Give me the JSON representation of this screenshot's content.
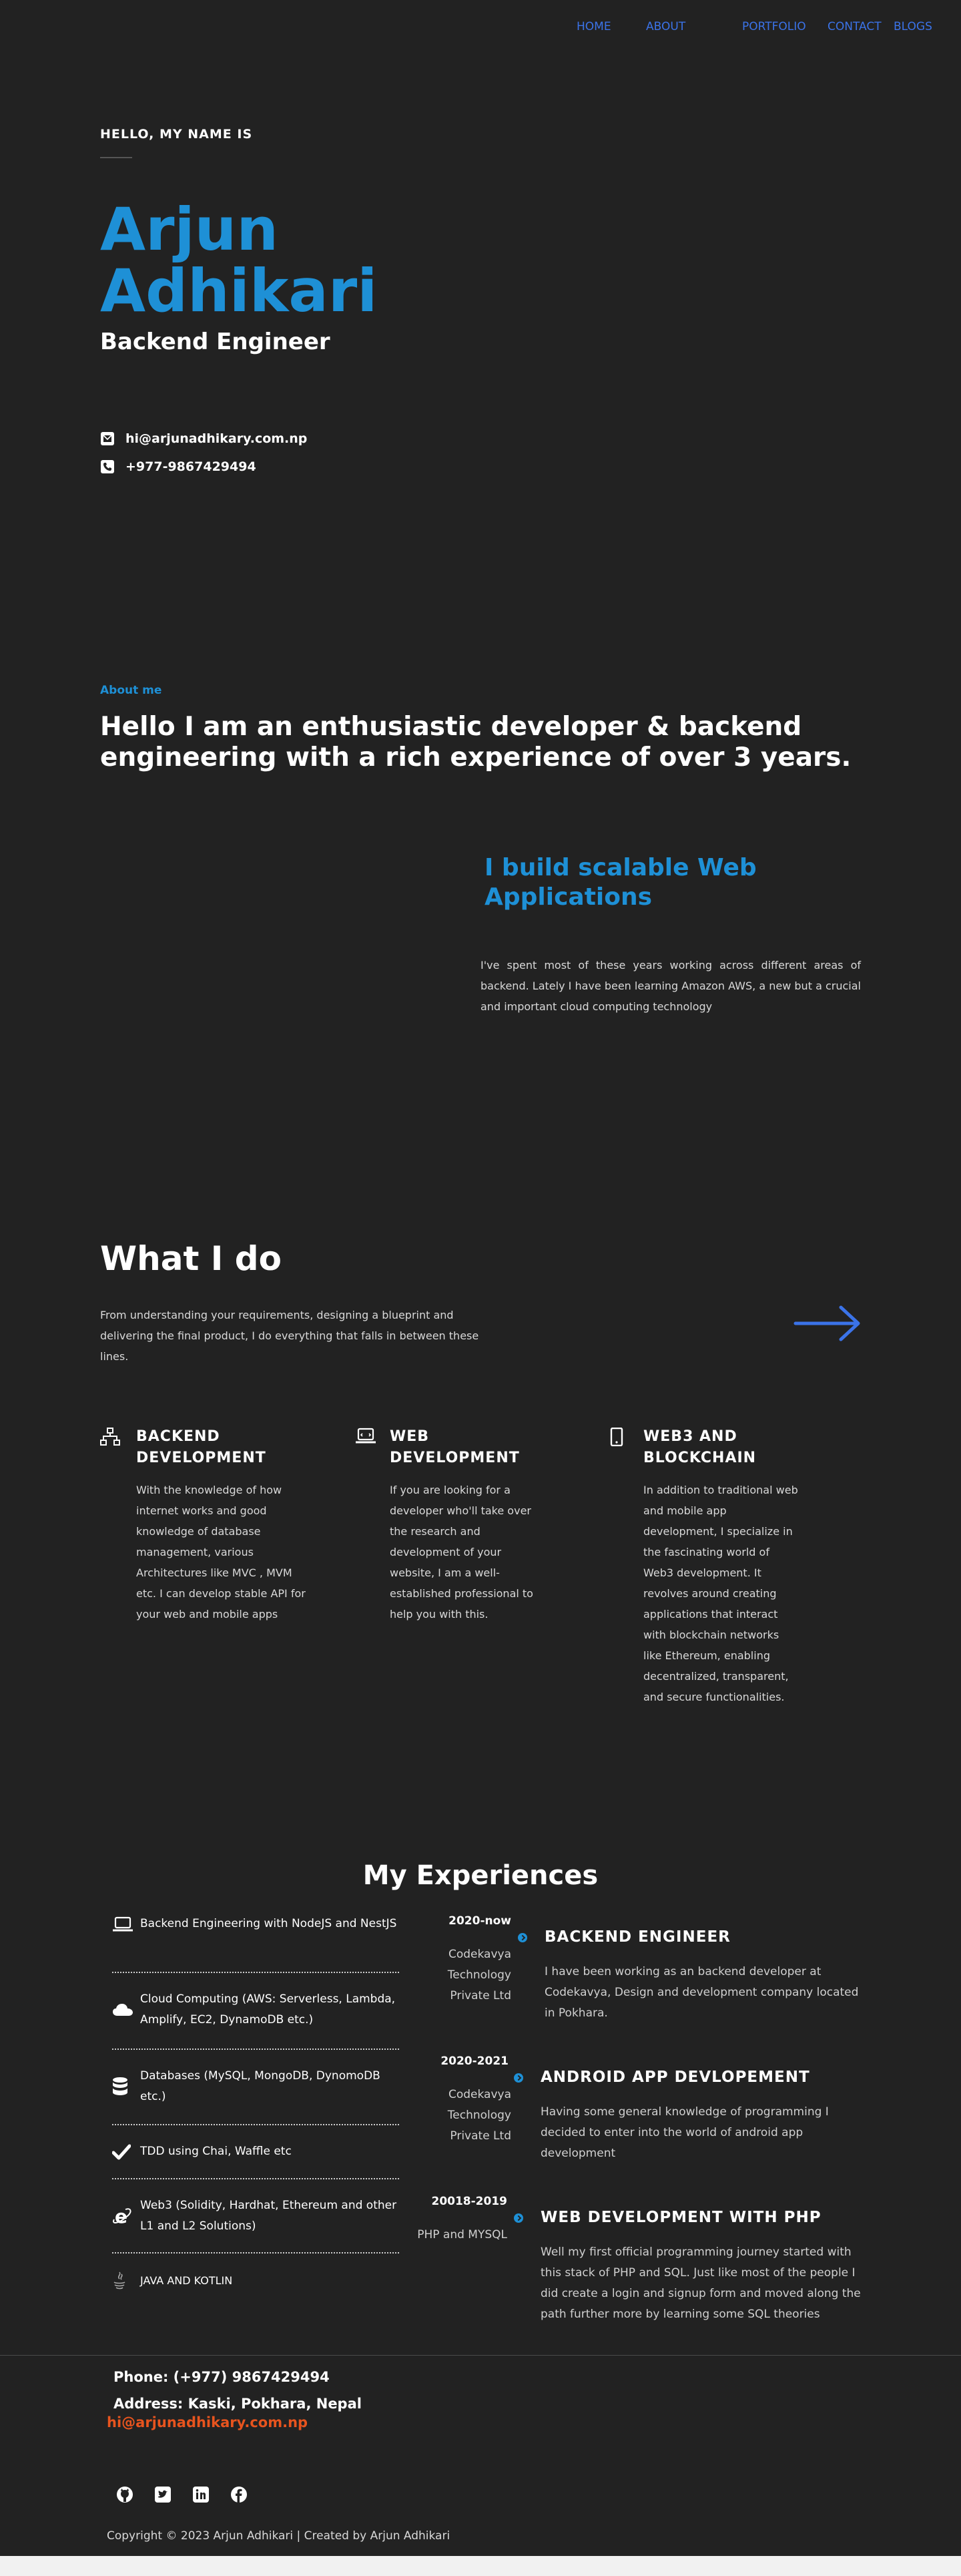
{
  "nav": {
    "home": "HOME",
    "about": "ABOUT",
    "portfolio": "PORTFOLIO",
    "contact": "CONTACT",
    "blogs": "BLOGS"
  },
  "hero": {
    "greeting": "HELLO, MY NAME IS",
    "first_name": "Arjun",
    "last_name": "Adhikari",
    "role": "Backend Engineer",
    "email": "hi@arjunadhikary.com.np",
    "phone": "+977-9867429494"
  },
  "about": {
    "label": "About me",
    "title": "Hello I am an enthusiastic developer & backend engineering with a rich experience of over 3 years.",
    "subtitle": "I build scalable Web Applications",
    "text": "I've spent most of these years working across different areas of backend. Lately I have been learning Amazon AWS, a new but a crucial and important cloud computing technology"
  },
  "what_i_do": {
    "title": "What I do",
    "text": "From understanding your requirements, designing a blueprint and delivering the final product, I do everything that falls in between these lines.",
    "services": [
      {
        "icon": "sitemap-icon",
        "title": "BACKEND DEVELOPMENT",
        "text": "With the knowledge of how internet works and good knowledge of database management, various Architectures like MVC , MVM etc. I can develop stable API for your web and mobile apps"
      },
      {
        "icon": "laptop-icon",
        "title": "WEB DEVELOPMENT",
        "text": "If you are looking for a developer who'll take over the research and development of your website, I am a well-established professional to help you with this."
      },
      {
        "icon": "mobile-icon",
        "title": "WEB3 AND BLOCKCHAIN",
        "text": "In addition to traditional web and mobile app development, I specialize in the fascinating world of Web3 development. It revolves around creating applications that interact with blockchain networks like Ethereum, enabling decentralized, transparent, and secure functionalities."
      }
    ]
  },
  "experiences": {
    "title": "My Experiences",
    "skills": [
      {
        "icon": "laptop-icon",
        "text": "Backend Engineering with NodeJS and NestJS"
      },
      {
        "icon": "cloud-icon",
        "text": "Cloud Computing (AWS: Serverless, Lambda, Amplify, EC2, DynamoDB etc.)"
      },
      {
        "icon": "database-icon",
        "text": "Databases (MySQL, MongoDB, DynomoDB etc.)"
      },
      {
        "icon": "check-icon",
        "text": "TDD using Chai, Waffle etc"
      },
      {
        "icon": "internet-explorer-icon",
        "text": "Web3 (Solidity, Hardhat, Ethereum and other L1 and L2 Solutions)"
      },
      {
        "icon": "java-icon",
        "text": "JAVA AND KOTLIN"
      }
    ],
    "timeline": [
      {
        "date": "2020-now",
        "org": "Codekavya Technology Private Ltd",
        "title": "BACKEND ENGINEER",
        "text": "I have been working as an backend developer at Codekavya, Design and development company located in Pokhara."
      },
      {
        "date": "2020-2021",
        "org": "Codekavya Technology Private Ltd",
        "title": "ANDROID APP DEVLOPEMENT",
        "text": "Having some general knowledge of programming I decided to enter into the world of android app development"
      },
      {
        "date": "20018-2019",
        "org": "PHP and MYSQL",
        "title": "WEB DEVELOPMENT WITH PHP",
        "text": "Well my first official programming journey started with this stack of PHP and SQL. Just like most of the people I did create a login and signup form and moved along the path further more by learning some SQL theories"
      }
    ]
  },
  "footer": {
    "phone": "Phone: (+977) 9867429494",
    "address": "Address: Kaski, Pokhara, Nepal",
    "email": "hi@arjunadhikary.com.np",
    "social": [
      "github-icon",
      "twitter-icon",
      "linkedin-icon",
      "facebook-icon"
    ],
    "copyright": "Copyright © 2023 Arjun Adhikari | Created by Arjun Adhikari"
  },
  "colors": {
    "background": "#222222",
    "accent": "#1e90d6",
    "nav": "#3b73e8",
    "footer_email": "#e8541e"
  }
}
